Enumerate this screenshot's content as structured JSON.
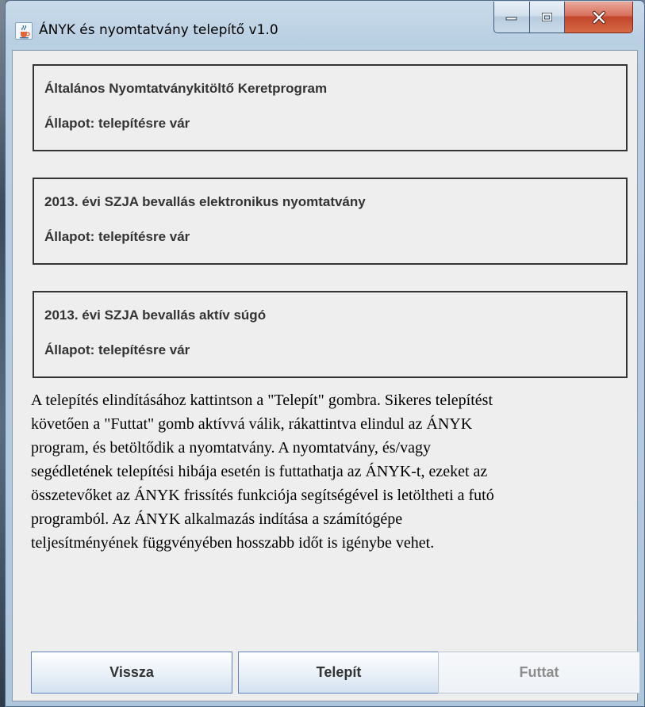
{
  "window": {
    "title": "ÁNYK és nyomtatvány telepítő v1.0",
    "icon": "java-cup-icon"
  },
  "caption_buttons": [
    {
      "name": "minimize",
      "icon": "minimize-icon"
    },
    {
      "name": "maximize",
      "icon": "maximize-icon"
    },
    {
      "name": "close",
      "icon": "close-icon"
    }
  ],
  "components": [
    {
      "name": "Általános Nyomtatványkitöltő Keretprogram",
      "status": "Állapot: telepítésre vár"
    },
    {
      "name": "2013. évi SZJA bevallás elektronikus nyomtatvány",
      "status": "Állapot: telepítésre vár"
    },
    {
      "name": "2013. évi SZJA bevallás aktív súgó",
      "status": "Állapot: telepítésre vár"
    }
  ],
  "description_lines": [
    "A telepítés elindításához kattintson a \"Telepít\" gombra. Sikeres telepítést",
    "követően a \"Futtat\" gomb aktívvá válik, rákattintva elindul az ÁNYK",
    "program, és betöltődik a nyomtatvány. A nyomtatvány, és/vagy",
    "segédletének telepítési hibája esetén is futtathatja az ÁNYK-t, ezeket az",
    "összetevőket az ÁNYK frissítés funkciója segítségével is letöltheti a futó",
    "programból. Az ÁNYK alkalmazás indítása a számítógépe",
    "teljesítményének függvényében hosszabb időt is igénybe vehet."
  ],
  "buttons": {
    "back": "Vissza",
    "install": "Telepít",
    "run": "Futtat",
    "run_enabled": false
  },
  "colors": {
    "close_button": "#c3452c",
    "disabled_text": "#8d8d8d",
    "panel_border": "#333333"
  }
}
